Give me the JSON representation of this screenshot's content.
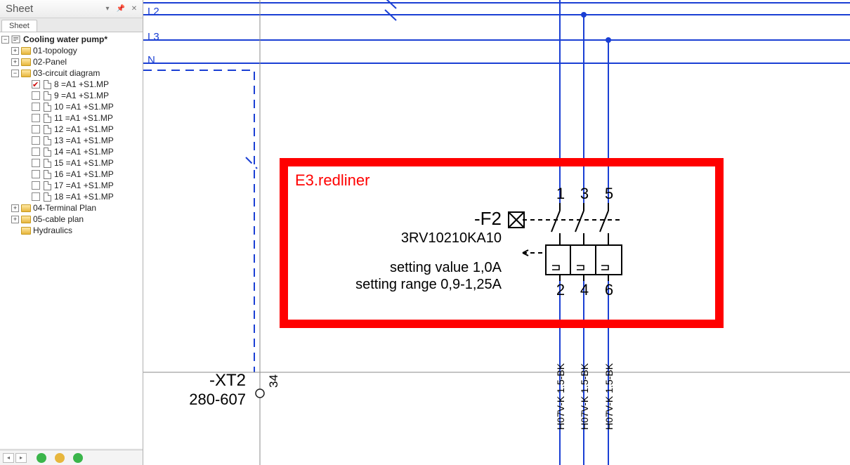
{
  "panel": {
    "title": "Sheet",
    "tab": "Sheet"
  },
  "tree": {
    "root": "Cooling water pump*",
    "folders": {
      "f0": "01-topology",
      "f1": "02-Panel",
      "f2": "03-circuit diagram",
      "f3": "04-Terminal Plan",
      "f4": "05-cable plan",
      "f5": "Hydraulics"
    },
    "sheets": [
      "8 =A1 +S1.MP",
      "9 =A1 +S1.MP",
      "10 =A1 +S1.MP",
      "11 =A1 +S1.MP",
      "12 =A1 +S1.MP",
      "13 =A1 +S1.MP",
      "14 =A1 +S1.MP",
      "15 =A1 +S1.MP",
      "16 =A1 +S1.MP",
      "17 =A1 +S1.MP",
      "18 =A1 +S1.MP"
    ]
  },
  "diagram": {
    "bus": {
      "L2": "L2",
      "L3": "L3",
      "N": "N"
    },
    "redliner": "E3.redliner",
    "component": {
      "ref": "-F2",
      "part": "3RV10210KA10",
      "setting_value": "setting value 1,0A",
      "setting_range": "setting range 0,9-1,25A",
      "pins_top": [
        "1",
        "3",
        "5"
      ],
      "pins_bottom": [
        "2",
        "4",
        "6"
      ]
    },
    "terminal": {
      "ref": "-XT2",
      "type": "280-607",
      "num": "34"
    },
    "wire": "H07V-K  1.5-BK"
  }
}
